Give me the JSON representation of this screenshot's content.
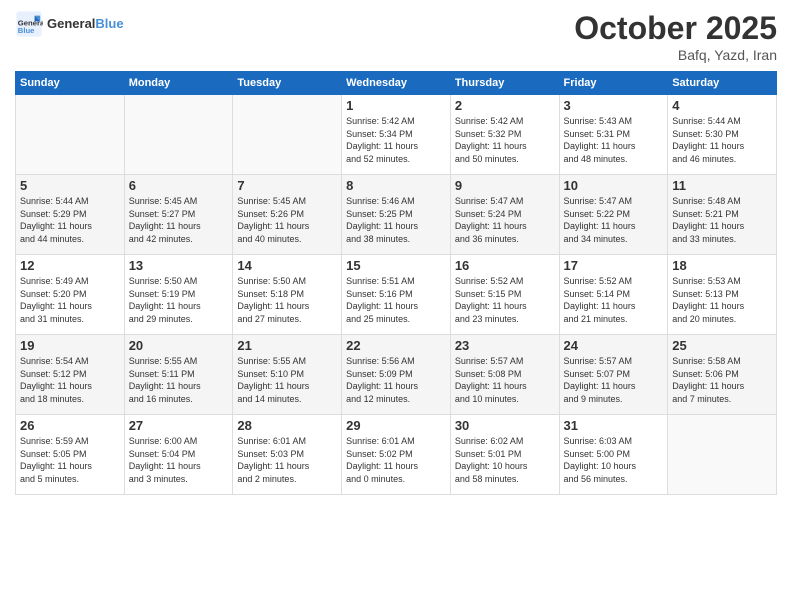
{
  "header": {
    "logo_general": "General",
    "logo_blue": "Blue",
    "month": "October 2025",
    "location": "Bafq, Yazd, Iran"
  },
  "weekdays": [
    "Sunday",
    "Monday",
    "Tuesday",
    "Wednesday",
    "Thursday",
    "Friday",
    "Saturday"
  ],
  "weeks": [
    [
      {
        "day": "",
        "info": ""
      },
      {
        "day": "",
        "info": ""
      },
      {
        "day": "",
        "info": ""
      },
      {
        "day": "1",
        "info": "Sunrise: 5:42 AM\nSunset: 5:34 PM\nDaylight: 11 hours\nand 52 minutes."
      },
      {
        "day": "2",
        "info": "Sunrise: 5:42 AM\nSunset: 5:32 PM\nDaylight: 11 hours\nand 50 minutes."
      },
      {
        "day": "3",
        "info": "Sunrise: 5:43 AM\nSunset: 5:31 PM\nDaylight: 11 hours\nand 48 minutes."
      },
      {
        "day": "4",
        "info": "Sunrise: 5:44 AM\nSunset: 5:30 PM\nDaylight: 11 hours\nand 46 minutes."
      }
    ],
    [
      {
        "day": "5",
        "info": "Sunrise: 5:44 AM\nSunset: 5:29 PM\nDaylight: 11 hours\nand 44 minutes."
      },
      {
        "day": "6",
        "info": "Sunrise: 5:45 AM\nSunset: 5:27 PM\nDaylight: 11 hours\nand 42 minutes."
      },
      {
        "day": "7",
        "info": "Sunrise: 5:45 AM\nSunset: 5:26 PM\nDaylight: 11 hours\nand 40 minutes."
      },
      {
        "day": "8",
        "info": "Sunrise: 5:46 AM\nSunset: 5:25 PM\nDaylight: 11 hours\nand 38 minutes."
      },
      {
        "day": "9",
        "info": "Sunrise: 5:47 AM\nSunset: 5:24 PM\nDaylight: 11 hours\nand 36 minutes."
      },
      {
        "day": "10",
        "info": "Sunrise: 5:47 AM\nSunset: 5:22 PM\nDaylight: 11 hours\nand 34 minutes."
      },
      {
        "day": "11",
        "info": "Sunrise: 5:48 AM\nSunset: 5:21 PM\nDaylight: 11 hours\nand 33 minutes."
      }
    ],
    [
      {
        "day": "12",
        "info": "Sunrise: 5:49 AM\nSunset: 5:20 PM\nDaylight: 11 hours\nand 31 minutes."
      },
      {
        "day": "13",
        "info": "Sunrise: 5:50 AM\nSunset: 5:19 PM\nDaylight: 11 hours\nand 29 minutes."
      },
      {
        "day": "14",
        "info": "Sunrise: 5:50 AM\nSunset: 5:18 PM\nDaylight: 11 hours\nand 27 minutes."
      },
      {
        "day": "15",
        "info": "Sunrise: 5:51 AM\nSunset: 5:16 PM\nDaylight: 11 hours\nand 25 minutes."
      },
      {
        "day": "16",
        "info": "Sunrise: 5:52 AM\nSunset: 5:15 PM\nDaylight: 11 hours\nand 23 minutes."
      },
      {
        "day": "17",
        "info": "Sunrise: 5:52 AM\nSunset: 5:14 PM\nDaylight: 11 hours\nand 21 minutes."
      },
      {
        "day": "18",
        "info": "Sunrise: 5:53 AM\nSunset: 5:13 PM\nDaylight: 11 hours\nand 20 minutes."
      }
    ],
    [
      {
        "day": "19",
        "info": "Sunrise: 5:54 AM\nSunset: 5:12 PM\nDaylight: 11 hours\nand 18 minutes."
      },
      {
        "day": "20",
        "info": "Sunrise: 5:55 AM\nSunset: 5:11 PM\nDaylight: 11 hours\nand 16 minutes."
      },
      {
        "day": "21",
        "info": "Sunrise: 5:55 AM\nSunset: 5:10 PM\nDaylight: 11 hours\nand 14 minutes."
      },
      {
        "day": "22",
        "info": "Sunrise: 5:56 AM\nSunset: 5:09 PM\nDaylight: 11 hours\nand 12 minutes."
      },
      {
        "day": "23",
        "info": "Sunrise: 5:57 AM\nSunset: 5:08 PM\nDaylight: 11 hours\nand 10 minutes."
      },
      {
        "day": "24",
        "info": "Sunrise: 5:57 AM\nSunset: 5:07 PM\nDaylight: 11 hours\nand 9 minutes."
      },
      {
        "day": "25",
        "info": "Sunrise: 5:58 AM\nSunset: 5:06 PM\nDaylight: 11 hours\nand 7 minutes."
      }
    ],
    [
      {
        "day": "26",
        "info": "Sunrise: 5:59 AM\nSunset: 5:05 PM\nDaylight: 11 hours\nand 5 minutes."
      },
      {
        "day": "27",
        "info": "Sunrise: 6:00 AM\nSunset: 5:04 PM\nDaylight: 11 hours\nand 3 minutes."
      },
      {
        "day": "28",
        "info": "Sunrise: 6:01 AM\nSunset: 5:03 PM\nDaylight: 11 hours\nand 2 minutes."
      },
      {
        "day": "29",
        "info": "Sunrise: 6:01 AM\nSunset: 5:02 PM\nDaylight: 11 hours\nand 0 minutes."
      },
      {
        "day": "30",
        "info": "Sunrise: 6:02 AM\nSunset: 5:01 PM\nDaylight: 10 hours\nand 58 minutes."
      },
      {
        "day": "31",
        "info": "Sunrise: 6:03 AM\nSunset: 5:00 PM\nDaylight: 10 hours\nand 56 minutes."
      },
      {
        "day": "",
        "info": ""
      }
    ]
  ]
}
